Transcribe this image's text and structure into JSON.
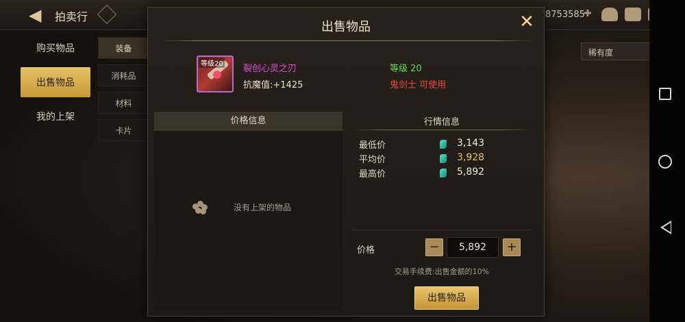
{
  "header": {
    "title": "拍卖行",
    "currency": "8753585"
  },
  "left_nav": {
    "items": [
      {
        "label": "购买物品"
      },
      {
        "label": "出售物品"
      },
      {
        "label": "我的上架"
      }
    ]
  },
  "sub_nav": {
    "items": [
      {
        "label": "装备"
      },
      {
        "label": "消耗品"
      },
      {
        "label": "材料"
      },
      {
        "label": "卡片"
      }
    ]
  },
  "filter": {
    "rarity_label": "稀有度"
  },
  "modal": {
    "title": "出售物品",
    "item": {
      "level_badge": "等级20",
      "name": "裂创心灵之刃",
      "stat": "抗魔值:+1425",
      "required_level": "等级 20",
      "class_restriction": "鬼剑士 可使用"
    },
    "price_panel": {
      "title": "价格信息",
      "empty_text": "没有上架的物品"
    },
    "market_panel": {
      "title": "行情信息",
      "stats": [
        {
          "label": "最低价",
          "value": "3,143",
          "color": "#f2eadb"
        },
        {
          "label": "平均价",
          "value": "3,928",
          "color": "#e6c55a"
        },
        {
          "label": "最高价",
          "value": "5,892",
          "color": "#f2eadb"
        }
      ]
    },
    "price_input": {
      "label": "价格",
      "value": "5,892",
      "minus": "−",
      "plus": "+"
    },
    "fee_text": "交易手续费:出售金额的10%",
    "sell_button": "出售物品"
  },
  "icons": {
    "back": "back-arrow-icon",
    "close": "close-icon",
    "gem": "gem-currency-icon",
    "empty": "empty-box-icon",
    "mail": "mail-icon",
    "chat": "chat-icon",
    "bag": "bag-icon"
  }
}
